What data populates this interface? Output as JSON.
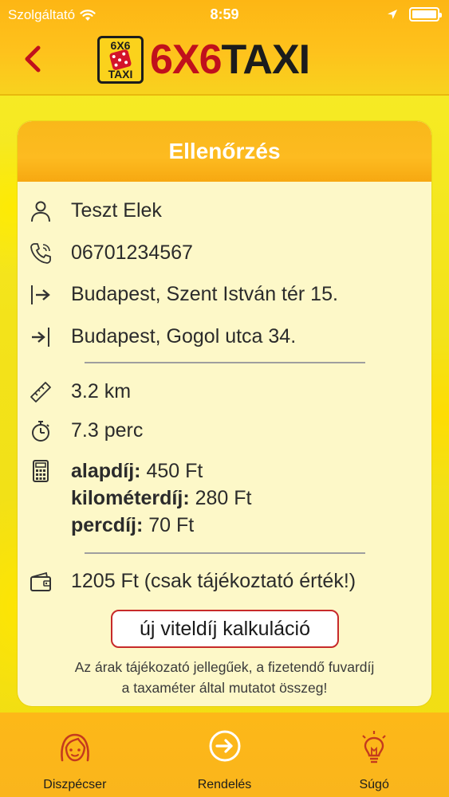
{
  "status_bar": {
    "carrier": "Szolgáltató",
    "time": "8:59"
  },
  "header": {
    "logo_text_part1": "6X6",
    "logo_text_part2": "TAXI",
    "badge_top": "6X6",
    "badge_bottom": "TAXI"
  },
  "card": {
    "title": "Ellenőrzés",
    "name": "Teszt Elek",
    "phone": "06701234567",
    "from_address": "Budapest, Szent István tér 15.",
    "to_address": "Budapest, Gogol utca 34.",
    "distance": "3.2 km",
    "duration": "7.3 perc",
    "fees": {
      "base_label": "alapdíj:",
      "base_value": "450 Ft",
      "km_label": "kilométerdíj:",
      "km_value": "280 Ft",
      "min_label": "percdíj:",
      "min_value": "70 Ft"
    },
    "total": "1205 Ft (csak tájékoztató érték!)",
    "calc_button": "új viteldíj kalkuláció",
    "note_line1": "Az árak tájékozató jellegűek, a fizetendő fuvardíj",
    "note_line2": "a taxaméter által mutatot összeg!"
  },
  "tabs": [
    {
      "label": "Diszpécser",
      "icon": "dispatcher-face-icon"
    },
    {
      "label": "Rendelés",
      "icon": "arrow-circle-icon"
    },
    {
      "label": "Súgó",
      "icon": "lightbulb-icon"
    }
  ],
  "colors": {
    "accent_orange": "#fdb818",
    "back_arrow_red": "#c0101c",
    "button_border": "#c72a2a",
    "card_bg": "#fdf8c8"
  }
}
